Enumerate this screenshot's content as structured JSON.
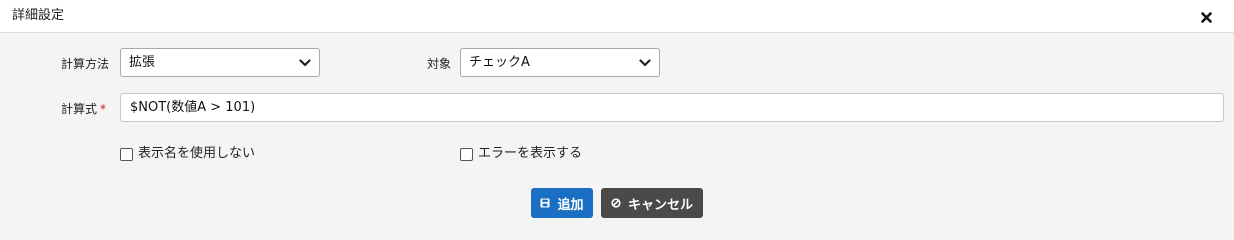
{
  "dialog": {
    "title": "詳細設定",
    "close_icon": "close-icon"
  },
  "form": {
    "calc_method": {
      "label": "計算方法",
      "selected": "拡張"
    },
    "target": {
      "label": "対象",
      "selected": "チェックA"
    },
    "formula": {
      "label": "計算式",
      "required_mark": "*",
      "value": "$NOT(数値A > 101)"
    },
    "hide_display_name": {
      "label": "表示名を使用しない",
      "checked": false
    },
    "show_error": {
      "label": "エラーを表示する",
      "checked": false
    }
  },
  "actions": {
    "add_label": "追加",
    "add_icon": "save-icon",
    "cancel_label": "キャンセル",
    "cancel_icon": "ban-icon"
  },
  "colors": {
    "primary": "#1a6fc2",
    "secondary": "#4a4a4a",
    "required": "#d6142a",
    "background": "#f4f4f4"
  }
}
